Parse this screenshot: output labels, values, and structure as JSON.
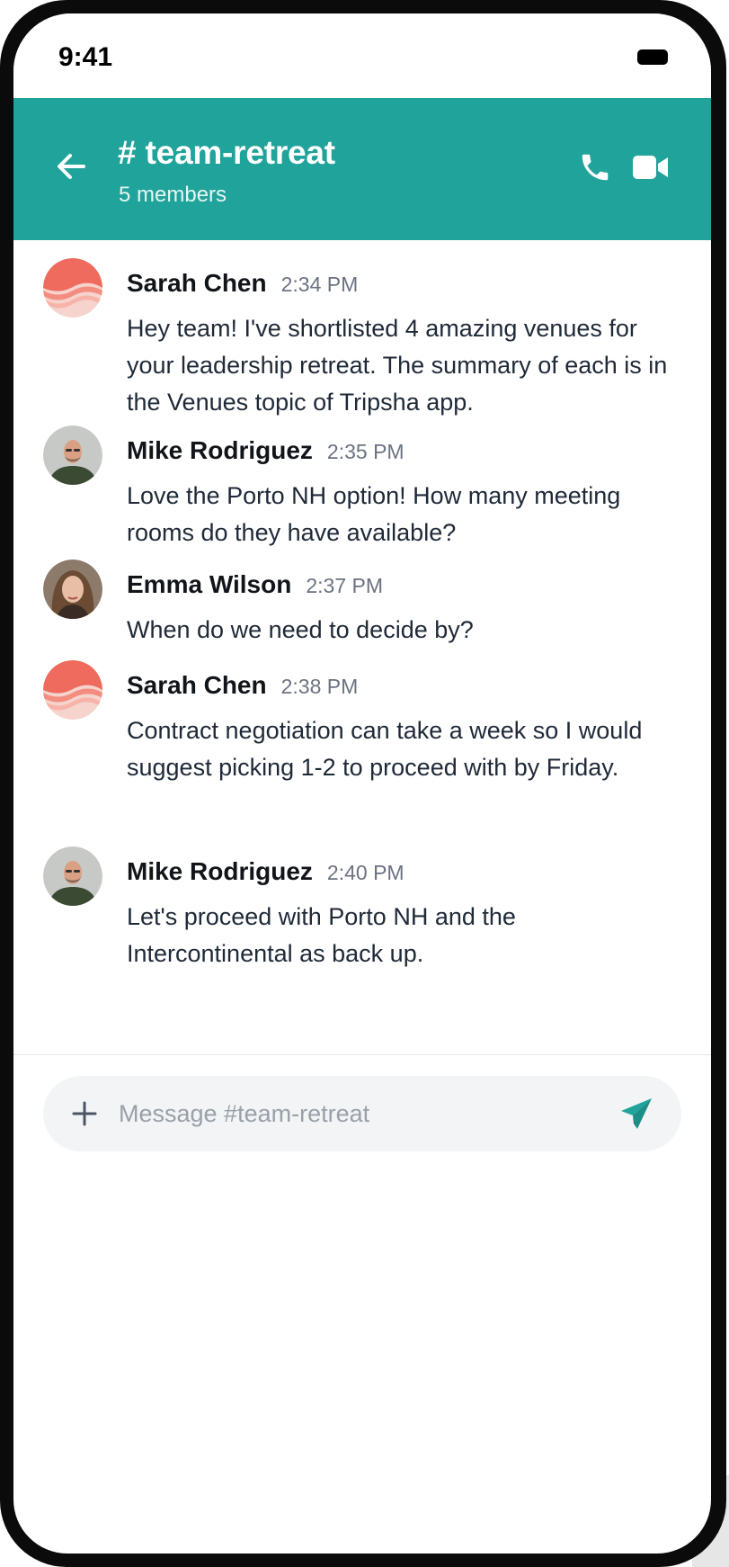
{
  "status_bar": {
    "time": "9:41"
  },
  "header": {
    "channel": "# team-retreat",
    "members": "5 members",
    "accent": "#20a39a"
  },
  "messages": [
    {
      "author": "Sarah Chen",
      "time": "2:34 PM",
      "text": "Hey team! I've shortlisted 4 amazing venues for your leadership retreat. The summary of each is in the Venues topic of Tripsha app.",
      "avatar": "waves-avatar"
    },
    {
      "author": "Mike Rodriguez",
      "time": "2:35 PM",
      "text": "Love the Porto NH option! How many meeting rooms do they have available?",
      "avatar": "man-photo-avatar"
    },
    {
      "author": "Emma Wilson",
      "time": "2:37 PM",
      "text": "When do we need to decide by?",
      "avatar": "woman-photo-avatar"
    },
    {
      "author": "Sarah Chen",
      "time": "2:38 PM",
      "text": "Contract negotiation can take a week so I would suggest picking 1-2 to proceed with by Friday.",
      "avatar": "waves-avatar"
    },
    {
      "author": "Mike Rodriguez",
      "time": "2:40 PM",
      "text": "Let's proceed with Porto NH and the Intercontinental as back up.",
      "avatar": "man-photo-avatar"
    }
  ],
  "composer": {
    "placeholder": "Message #team-retreat",
    "value": ""
  }
}
